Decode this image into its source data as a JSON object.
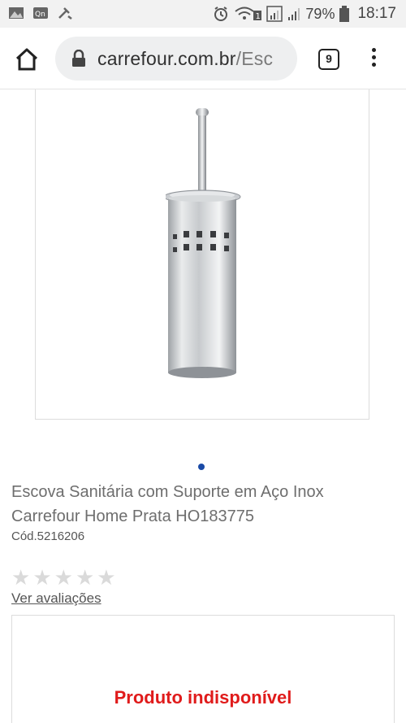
{
  "status_bar": {
    "battery_percent": "79%",
    "time": "18:17",
    "sim_badge": "1"
  },
  "browser": {
    "url_domain": "carrefour.com.br",
    "url_path": "/Esc",
    "tab_count": "9"
  },
  "product": {
    "title": "Escova Sanitária com Suporte em Aço Inox Carrefour Home Prata HO183775",
    "code": "Cód.5216206",
    "rating_stars": 0,
    "reviews_link": "Ver avaliações",
    "availability": "Produto indisponível",
    "gallery_active_index": 0
  },
  "colors": {
    "accent_dot": "#1a4aa6",
    "unavailable": "#e01b1b",
    "star_empty": "#dadada"
  }
}
